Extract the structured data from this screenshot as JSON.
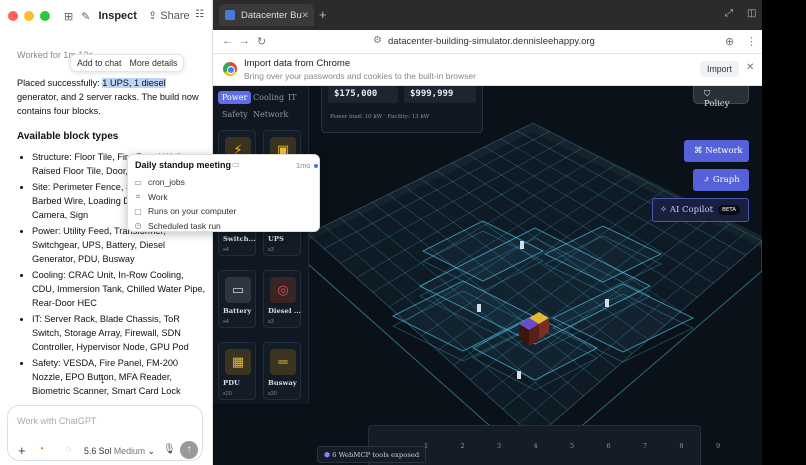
{
  "chat": {
    "window_title": "Inspect",
    "share_label": "Share",
    "worked_text": "Worked for 1m 12s",
    "hover_actions": [
      "Add to chat",
      "More details"
    ],
    "placed_before": "Placed successfully: ",
    "placed_highlight": "1 UPS, 1 diesel",
    "placed_after": " generator, and 2 server racks. The build now contains four blocks.",
    "blocks_heading": "Available block types",
    "block_types": [
      "Structure: Floor Tile, Fire-Rated Wall, Raised Floor Tile, Door, Security Portal",
      "Site: Perimeter Fence, Security Bollard, Barbed Wire, Loading Dock, CCTV Camera, Sign",
      "Power: Utility Feed, Transformer, Switchgear, UPS, Battery, Diesel Generator, PDU, Busway",
      "Cooling: CRAC Unit, In-Row Cooling, CDU, Immersion Tank, Chilled Water Pipe, Rear-Door HEC",
      "IT: Server Rack, Blade Chassis, ToR Switch, Storage Array, Firewall, SDN Controller, Hypervisor Node, GPU Pod",
      "Safety: VESDA, Fire Panel, FM-200 Nozzle, EPO Button, MFA Reader, Biometric Scanner, Smart Card Lock"
    ],
    "composer_placeholder": "Work with ChatGPT",
    "model_label": "5.6 Sol",
    "effort_label": "Medium"
  },
  "popup": {
    "title": "Daily standup meeting",
    "ago": "1mo",
    "rows": [
      {
        "icon": "folder-icon",
        "glyph": "▭",
        "label": "cron_jobs"
      },
      {
        "icon": "work-icon",
        "glyph": "⌗",
        "label": "Work"
      },
      {
        "icon": "computer-icon",
        "glyph": "▢",
        "label": "Runs on your computer"
      },
      {
        "icon": "clock-icon",
        "glyph": "◷",
        "label": "Scheduled task run"
      }
    ]
  },
  "browser": {
    "tab_title": "Datacenter Bu",
    "url": "datacenter-building-simulator.dennisleehappy.org",
    "import_title": "Import data from Chrome",
    "import_sub": "Bring over your passwords and cookies to the built-in browser",
    "import_button": "Import"
  },
  "app": {
    "categories": [
      "Power",
      "Cooling",
      "IT",
      "Safety",
      "Network"
    ],
    "active_category": "Power",
    "tiles": [
      {
        "name": "Switch...",
        "count": "x4",
        "glyph": "◫",
        "bg": "#3a3d44",
        "fg": "#c8cbd2"
      },
      {
        "name": "UPS",
        "count": "x3",
        "glyph": "⚡",
        "bg": "#3a3320",
        "fg": "#f2c230"
      },
      {
        "name": "Battery",
        "count": "x4",
        "glyph": "▭",
        "bg": "#2e3440",
        "fg": "#c8cfdb"
      },
      {
        "name": "Diesel ...",
        "count": "x3",
        "glyph": "◎",
        "bg": "#3a2424",
        "fg": "#e05050"
      },
      {
        "name": "PDU",
        "count": "x20",
        "glyph": "▦",
        "bg": "#3a3420",
        "fg": "#e2b93a"
      },
      {
        "name": "Busway",
        "count": "x30",
        "glyph": "═",
        "bg": "#3a3420",
        "fg": "#f0c040"
      }
    ],
    "capex": "$175,000",
    "budget": "$999,999",
    "power_note": "Power load: 10 kW · Facility: 13 kW",
    "policy_label": "Policy",
    "network_label": "Network",
    "graph_label": "Graph",
    "copilot_label": "AI Copilot",
    "beta_label": "BETA",
    "timeline_slots": [
      "1",
      "2",
      "3",
      "4",
      "5",
      "6",
      "7",
      "8",
      "9"
    ],
    "webmcp_label": "6 WebMCP tools exposed"
  },
  "colors": {
    "accent": "#5f6fe3",
    "grid": "#4fc3e8",
    "highlight": "#bcd4f6"
  }
}
